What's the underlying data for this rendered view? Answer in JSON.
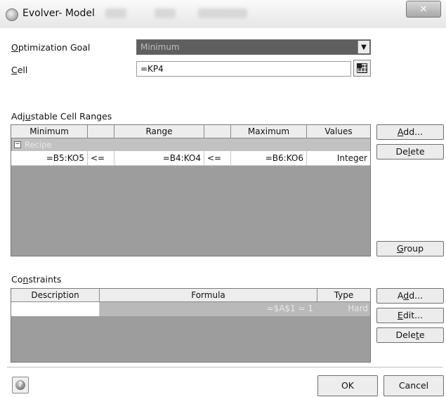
{
  "window": {
    "title": "Evolver- Model",
    "close_glyph": "✕",
    "app_icon": "evolver-app-icon"
  },
  "goal": {
    "label": "Optimization Goal",
    "value": "Minimum",
    "dropdown_glyph": "▼"
  },
  "cell": {
    "label": "Cell",
    "value": "=KP4"
  },
  "adjustable": {
    "section_label": "Adjustable Cell Ranges",
    "headers": {
      "minimum": "Minimum",
      "range": "Range",
      "maximum": "Maximum",
      "values": "Values"
    },
    "group": {
      "toggle_glyph": "−",
      "name": "Recipe"
    },
    "row": {
      "minimum": "=B5:KO5",
      "op1": "<=",
      "range": "=B4:KO4",
      "op2": "<=",
      "maximum": "=B6:KO6",
      "values": "Integer"
    },
    "buttons": {
      "add": "Add...",
      "delete": "Delete",
      "group": "Group"
    }
  },
  "constraints": {
    "section_label": "Constraints",
    "headers": {
      "description": "Description",
      "formula": "Formula",
      "type": "Type"
    },
    "row": {
      "description": "",
      "formula": "=$A$1 = 1",
      "type": "Hard"
    },
    "buttons": {
      "add": "Add...",
      "edit": "Edit...",
      "delete": "Delete"
    }
  },
  "footer": {
    "help_glyph": "?",
    "ok": "OK",
    "cancel": "Cancel"
  },
  "colors": {
    "selected_combo": "#5f5f5f",
    "grid_background": "#9d9d9d",
    "group_row": "#c2c2c2"
  }
}
